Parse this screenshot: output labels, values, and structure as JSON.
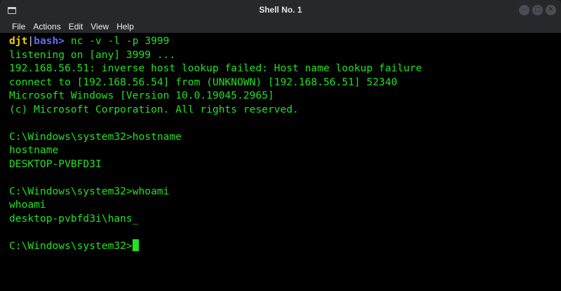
{
  "window": {
    "title": "Shell No. 1",
    "controls": {
      "minimize": "–",
      "maximize": "□",
      "close": "✕"
    }
  },
  "menu": {
    "items": [
      "File",
      "Actions",
      "Edit",
      "View",
      "Help"
    ]
  },
  "terminal": {
    "prompt": {
      "user": "djt",
      "separator": "|",
      "shell": "bash>",
      "command": " nc -v -l -p 3999"
    },
    "lines": [
      "listening on [any] 3999 ...",
      "192.168.56.51: inverse host lookup failed: Host name lookup failure",
      "connect to [192.168.56.54] from (UNKNOWN) [192.168.56.51] 52340",
      "Microsoft Windows [Version 10.0.19045.2965]",
      "(c) Microsoft Corporation. All rights reserved.",
      "",
      "C:\\Windows\\system32>hostname",
      "hostname",
      "DESKTOP-PVBFD3I",
      "",
      "C:\\Windows\\system32>whoami",
      "whoami",
      "desktop-pvbfd3i\\hans_",
      ""
    ],
    "current_prompt": "C:\\Windows\\system32>"
  },
  "colors": {
    "text": "#22e022",
    "user": "#f0d000",
    "shell": "#5c6cf2",
    "background": "#000000",
    "titlebar": "#26282c"
  }
}
